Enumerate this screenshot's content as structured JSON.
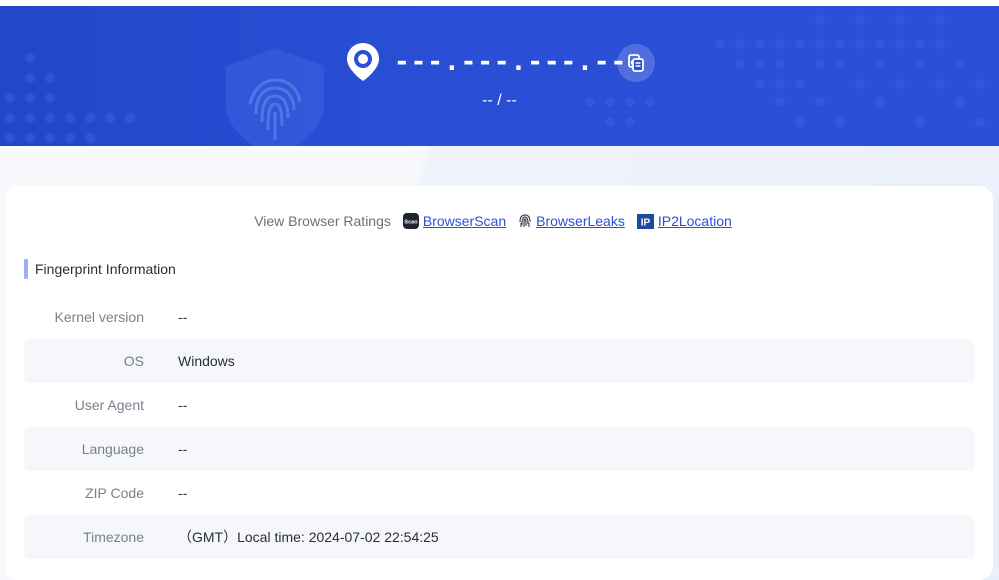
{
  "header": {
    "ip": "---.---.---.---",
    "location": "-- / --",
    "icons": {
      "pin": "location-pin-icon",
      "copy": "copy-icon",
      "shield": "fingerprint-shield-icon"
    },
    "colors": {
      "hero_blue": "#2b50d8",
      "link_blue": "#2b50d8"
    }
  },
  "ratings": {
    "label": "View Browser Ratings",
    "links": [
      {
        "label": "BrowserScan",
        "icon": "browserscan-icon",
        "icon_text": "Scan"
      },
      {
        "label": "BrowserLeaks",
        "icon": "fingerprint-icon"
      },
      {
        "label": "IP2Location",
        "icon": "ip2location-icon",
        "icon_text": "IP"
      }
    ]
  },
  "section": {
    "title": "Fingerprint Information"
  },
  "rows": [
    {
      "key": "Kernel version",
      "value": "--"
    },
    {
      "key": "OS",
      "value": "Windows"
    },
    {
      "key": "User Agent",
      "value": "--"
    },
    {
      "key": "Language",
      "value": "--"
    },
    {
      "key": "ZIP Code",
      "value": "--"
    },
    {
      "key": "Timezone",
      "value": "（GMT）Local time: 2024-07-02 22:54:25"
    }
  ]
}
